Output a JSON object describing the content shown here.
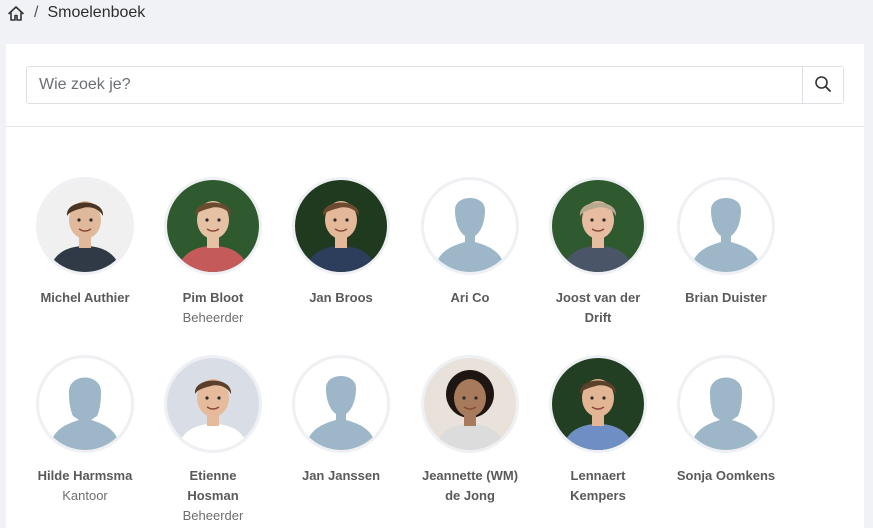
{
  "breadcrumb": {
    "home_icon": "home-icon",
    "separator": "/",
    "current": "Smoelenboek"
  },
  "search": {
    "placeholder": "Wie zoek je?",
    "value": "",
    "icon": "search-icon"
  },
  "colors": {
    "silhouette": "#9db6c8",
    "background": "#f1f2f6",
    "text": "#5a5a5a"
  },
  "people": [
    {
      "name": "Michel Authier",
      "role": "",
      "avatar": "photo",
      "tone": "#f0f0f0",
      "skin": "#e0b89a",
      "hair": "#4a3424",
      "shirt": "#2f3a46"
    },
    {
      "name": "Pim Bloot",
      "role": "Beheerder",
      "avatar": "photo",
      "tone": "#2f5a2f",
      "skin": "#e7c1a3",
      "hair": "#6b4b2f",
      "shirt": "#c45a5a"
    },
    {
      "name": "Jan Broos",
      "role": "",
      "avatar": "photo",
      "tone": "#1f3a1f",
      "skin": "#e4b99a",
      "hair": "#6b4a30",
      "shirt": "#2c3e5c"
    },
    {
      "name": "Ari Co",
      "role": "",
      "avatar": "male-silhouette"
    },
    {
      "name": "Joost van der Drift",
      "role": "",
      "avatar": "photo",
      "tone": "#2f5a30",
      "skin": "#e7bca0",
      "hair": "#b7a890",
      "shirt": "#4a5568"
    },
    {
      "name": "Brian Duister",
      "role": "",
      "avatar": "male-silhouette"
    },
    {
      "name": "Hilde Harmsma",
      "role": "Kantoor",
      "avatar": "female-silhouette"
    },
    {
      "name": "Etienne Hosman",
      "role": "Beheerder",
      "avatar": "photo",
      "tone": "#d9dde6",
      "skin": "#e6bb9b",
      "hair": "#5a3f2a",
      "shirt": "#ffffff"
    },
    {
      "name": "Jan Janssen",
      "role": "",
      "avatar": "male-silhouette"
    },
    {
      "name": "Jeannette (WM) de Jong",
      "role": "",
      "avatar": "photo",
      "tone": "#e8e2da",
      "skin": "#a87a5c",
      "hair": "#1e1612",
      "shirt": "#dcdcdc"
    },
    {
      "name": "Lennaert Kempers",
      "role": "",
      "avatar": "photo",
      "tone": "#233f23",
      "skin": "#e2b595",
      "hair": "#5b4129",
      "shirt": "#6f8fc4"
    },
    {
      "name": "Sonja Oomkens",
      "role": "",
      "avatar": "female-silhouette"
    }
  ]
}
